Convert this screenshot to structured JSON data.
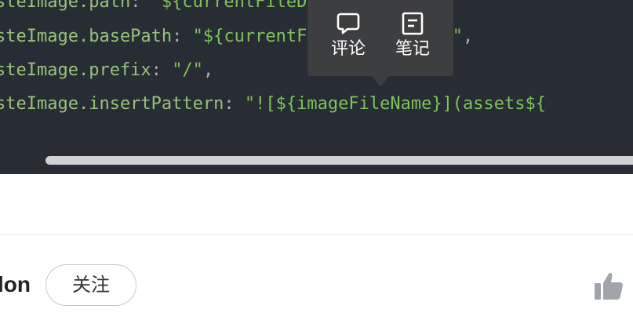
{
  "code": {
    "lines": [
      {
        "key": "steImage.path",
        "sep": ": ",
        "value": "\"${currentFileDir}/assets\"",
        "end": ","
      },
      {
        "key": "steImage.basePath",
        "sep": ": ",
        "value": "\"${currentFileDir}/assets\"",
        "end": ","
      },
      {
        "key": "steImage.prefix",
        "sep": ": ",
        "value": "\"/\"",
        "end": ","
      },
      {
        "key": "steImage.insertPattern",
        "sep": ": ",
        "value": "\"![${imageFileName}](assets${",
        "end": ""
      }
    ]
  },
  "tooltip": {
    "comment_label": "评论",
    "comment_icon": "speech-bubble-icon",
    "note_label": "笔记",
    "note_icon": "note-icon"
  },
  "author": {
    "name": "lon",
    "follow_label": "关注"
  },
  "actions": {
    "like_icon": "thumbs-up-icon"
  },
  "colors": {
    "code_bg": "#282c34",
    "code_key": "#98c379",
    "code_string": "#7ec35a",
    "tooltip_bg": "#3d3e40",
    "like_icon": "#a0a4ab"
  }
}
